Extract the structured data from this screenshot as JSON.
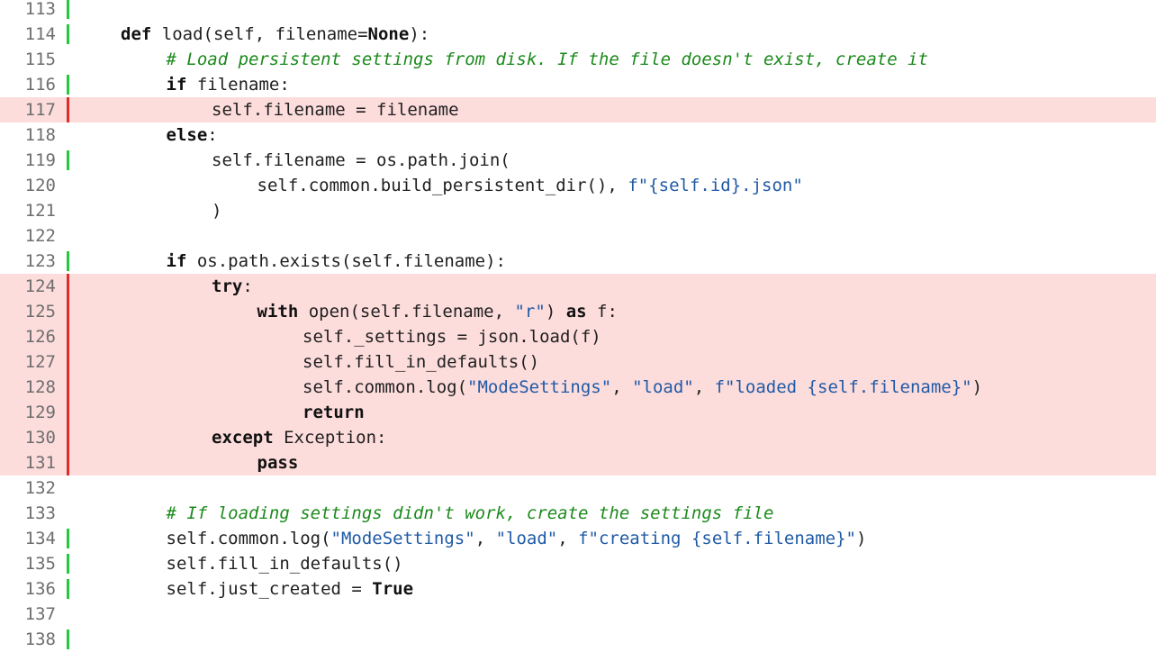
{
  "colors": {
    "covered_marker": "#22c93a",
    "uncovered_marker": "#e12b2b",
    "uncovered_background": "#fddcdc",
    "keyword": "#111111",
    "string": "#1f5aa6",
    "comment": "#1c8a1c"
  },
  "lines": [
    {
      "n": "113",
      "status": "covered",
      "indent": 0,
      "tokens": []
    },
    {
      "n": "114",
      "status": "covered",
      "indent": 1,
      "tokens": [
        [
          "kw",
          "def"
        ],
        [
          "plain",
          " load(self, filename="
        ],
        [
          "kw",
          "None"
        ],
        [
          "plain",
          "):"
        ]
      ]
    },
    {
      "n": "115",
      "status": "none",
      "indent": 2,
      "tokens": [
        [
          "com",
          "# Load persistent settings from disk. If the file doesn't exist, create it"
        ]
      ]
    },
    {
      "n": "116",
      "status": "covered",
      "indent": 2,
      "tokens": [
        [
          "kw",
          "if"
        ],
        [
          "plain",
          " filename:"
        ]
      ]
    },
    {
      "n": "117",
      "status": "uncovered",
      "indent": 3,
      "tokens": [
        [
          "plain",
          "self.filename = filename"
        ]
      ]
    },
    {
      "n": "118",
      "status": "none",
      "indent": 2,
      "tokens": [
        [
          "kw",
          "else"
        ],
        [
          "plain",
          ":"
        ]
      ]
    },
    {
      "n": "119",
      "status": "covered",
      "indent": 3,
      "tokens": [
        [
          "plain",
          "self.filename = os.path.join("
        ]
      ]
    },
    {
      "n": "120",
      "status": "none",
      "indent": 4,
      "tokens": [
        [
          "plain",
          "self.common.build_persistent_dir(), "
        ],
        [
          "str",
          "f\"{self.id}.json\""
        ]
      ]
    },
    {
      "n": "121",
      "status": "none",
      "indent": 3,
      "tokens": [
        [
          "plain",
          ")"
        ]
      ]
    },
    {
      "n": "122",
      "status": "none",
      "indent": 0,
      "tokens": []
    },
    {
      "n": "123",
      "status": "covered",
      "indent": 2,
      "tokens": [
        [
          "kw",
          "if"
        ],
        [
          "plain",
          " os.path.exists(self.filename):"
        ]
      ]
    },
    {
      "n": "124",
      "status": "uncovered",
      "indent": 3,
      "tokens": [
        [
          "kw",
          "try"
        ],
        [
          "plain",
          ":"
        ]
      ]
    },
    {
      "n": "125",
      "status": "uncovered",
      "indent": 4,
      "tokens": [
        [
          "kw",
          "with"
        ],
        [
          "plain",
          " open(self.filename, "
        ],
        [
          "str",
          "\"r\""
        ],
        [
          "plain",
          ") "
        ],
        [
          "kw",
          "as"
        ],
        [
          "plain",
          " f:"
        ]
      ]
    },
    {
      "n": "126",
      "status": "uncovered",
      "indent": 5,
      "tokens": [
        [
          "plain",
          "self._settings = json.load(f)"
        ]
      ]
    },
    {
      "n": "127",
      "status": "uncovered",
      "indent": 5,
      "tokens": [
        [
          "plain",
          "self.fill_in_defaults()"
        ]
      ]
    },
    {
      "n": "128",
      "status": "uncovered",
      "indent": 5,
      "tokens": [
        [
          "plain",
          "self.common.log("
        ],
        [
          "str",
          "\"ModeSettings\""
        ],
        [
          "plain",
          ", "
        ],
        [
          "str",
          "\"load\""
        ],
        [
          "plain",
          ", "
        ],
        [
          "str",
          "f\"loaded {self.filename}\""
        ],
        [
          "plain",
          ")"
        ]
      ]
    },
    {
      "n": "129",
      "status": "uncovered",
      "indent": 5,
      "tokens": [
        [
          "kw",
          "return"
        ]
      ]
    },
    {
      "n": "130",
      "status": "uncovered",
      "indent": 3,
      "tokens": [
        [
          "kw",
          "except"
        ],
        [
          "plain",
          " Exception:"
        ]
      ]
    },
    {
      "n": "131",
      "status": "uncovered",
      "indent": 4,
      "tokens": [
        [
          "kw",
          "pass"
        ]
      ]
    },
    {
      "n": "132",
      "status": "none",
      "indent": 0,
      "tokens": []
    },
    {
      "n": "133",
      "status": "none",
      "indent": 2,
      "tokens": [
        [
          "com",
          "# If loading settings didn't work, create the settings file"
        ]
      ]
    },
    {
      "n": "134",
      "status": "covered",
      "indent": 2,
      "tokens": [
        [
          "plain",
          "self.common.log("
        ],
        [
          "str",
          "\"ModeSettings\""
        ],
        [
          "plain",
          ", "
        ],
        [
          "str",
          "\"load\""
        ],
        [
          "plain",
          ", "
        ],
        [
          "str",
          "f\"creating {self.filename}\""
        ],
        [
          "plain",
          ")"
        ]
      ]
    },
    {
      "n": "135",
      "status": "covered",
      "indent": 2,
      "tokens": [
        [
          "plain",
          "self.fill_in_defaults()"
        ]
      ]
    },
    {
      "n": "136",
      "status": "covered",
      "indent": 2,
      "tokens": [
        [
          "plain",
          "self.just_created = "
        ],
        [
          "kw",
          "True"
        ]
      ]
    },
    {
      "n": "137",
      "status": "none",
      "indent": 0,
      "tokens": []
    },
    {
      "n": "138",
      "status": "covered",
      "indent": 0,
      "tokens": []
    }
  ]
}
